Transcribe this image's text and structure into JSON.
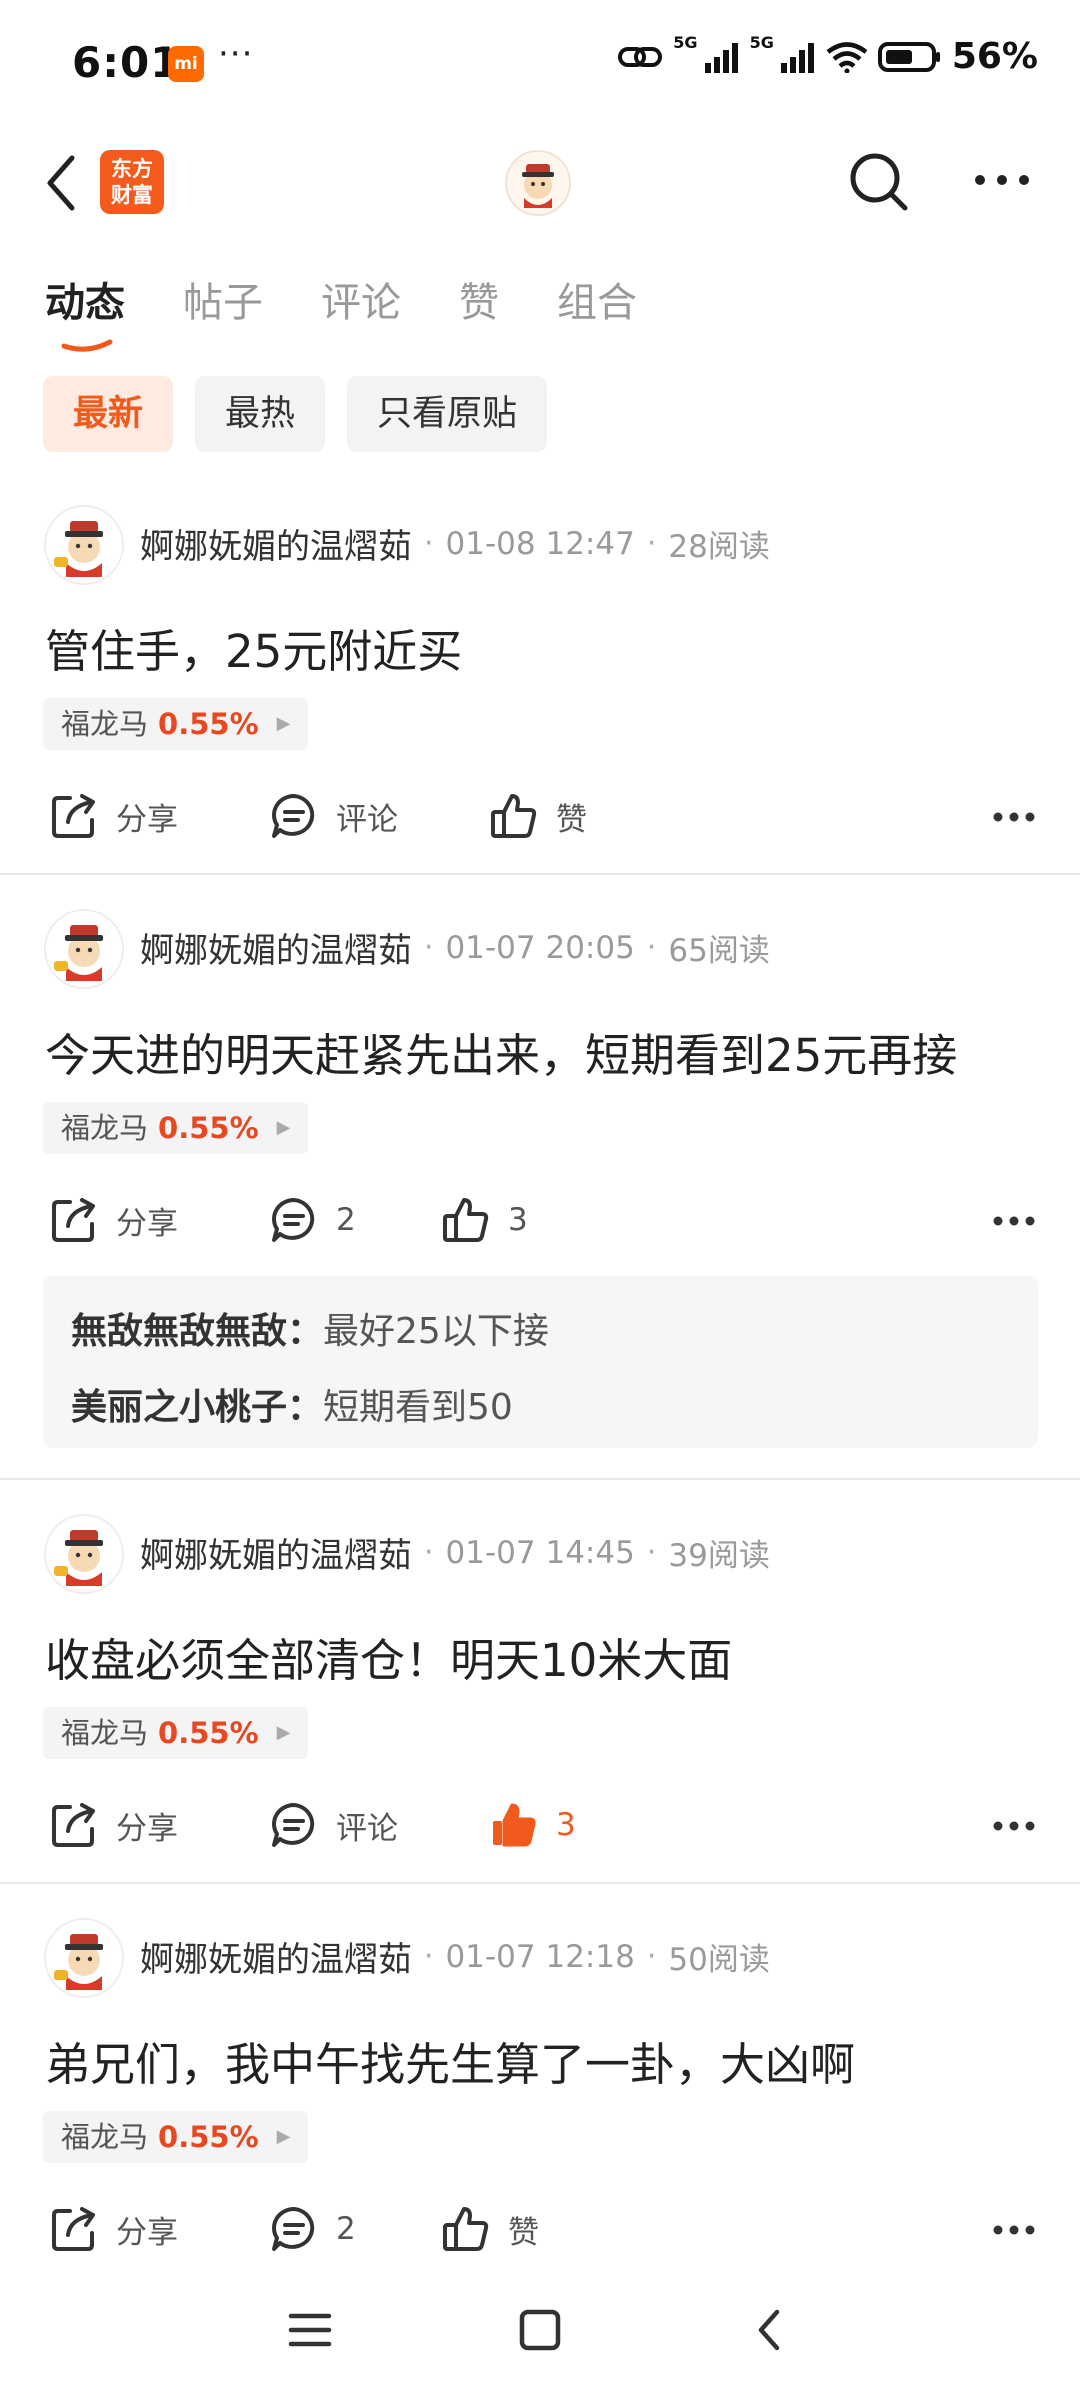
{
  "status": {
    "time": "6:01",
    "mi_badge": "mi",
    "dots": "···",
    "battery_pct": "56%",
    "network": "5G"
  },
  "header": {
    "logo_line1": "东方",
    "logo_line2": "财富",
    "icons": [
      "back-icon",
      "avatar",
      "search-icon",
      "more-icon"
    ]
  },
  "tabs": [
    {
      "label": "动态",
      "active": true
    },
    {
      "label": "帖子",
      "active": false
    },
    {
      "label": "评论",
      "active": false
    },
    {
      "label": "赞",
      "active": false
    },
    {
      "label": "组合",
      "active": false
    }
  ],
  "filters": [
    {
      "label": "最新",
      "active": true
    },
    {
      "label": "最热",
      "active": false
    },
    {
      "label": "只看原贴",
      "active": false
    }
  ],
  "colors": {
    "accent": "#f05a1c",
    "up": "#e8481f"
  },
  "posts": [
    {
      "author": "婀娜妩媚的温熠茹",
      "date": "01-08 12:47",
      "reads": "28阅读",
      "content": "管住手，25元附近买",
      "stock": {
        "name": "福龙马",
        "change": "0.55%"
      },
      "share": "分享",
      "comment": "评论",
      "like": "赞",
      "liked": false
    },
    {
      "author": "婀娜妩媚的温熠茹",
      "date": "01-07 20:05",
      "reads": "65阅读",
      "content": "今天进的明天赶紧先出来，短期看到25元再接",
      "stock": {
        "name": "福龙马",
        "change": "0.55%"
      },
      "share": "分享",
      "comment": "2",
      "like": "3",
      "liked": false,
      "comments": [
        {
          "name": "無敌無敌無敌：",
          "text": "最好25以下接"
        },
        {
          "name": "美丽之小桃子：",
          "text": "短期看到50"
        }
      ]
    },
    {
      "author": "婀娜妩媚的温熠茹",
      "date": "01-07 14:45",
      "reads": "39阅读",
      "content": "收盘必须全部清仓！明天10米大面",
      "stock": {
        "name": "福龙马",
        "change": "0.55%"
      },
      "share": "分享",
      "comment": "评论",
      "like": "3",
      "liked": true
    },
    {
      "author": "婀娜妩媚的温熠茹",
      "date": "01-07 12:18",
      "reads": "50阅读",
      "content": "弟兄们，我中午找先生算了一卦，大凶啊",
      "stock": {
        "name": "福龙马",
        "change": "0.55%"
      },
      "share": "分享",
      "comment": "2",
      "like": "赞",
      "liked": false
    }
  ]
}
